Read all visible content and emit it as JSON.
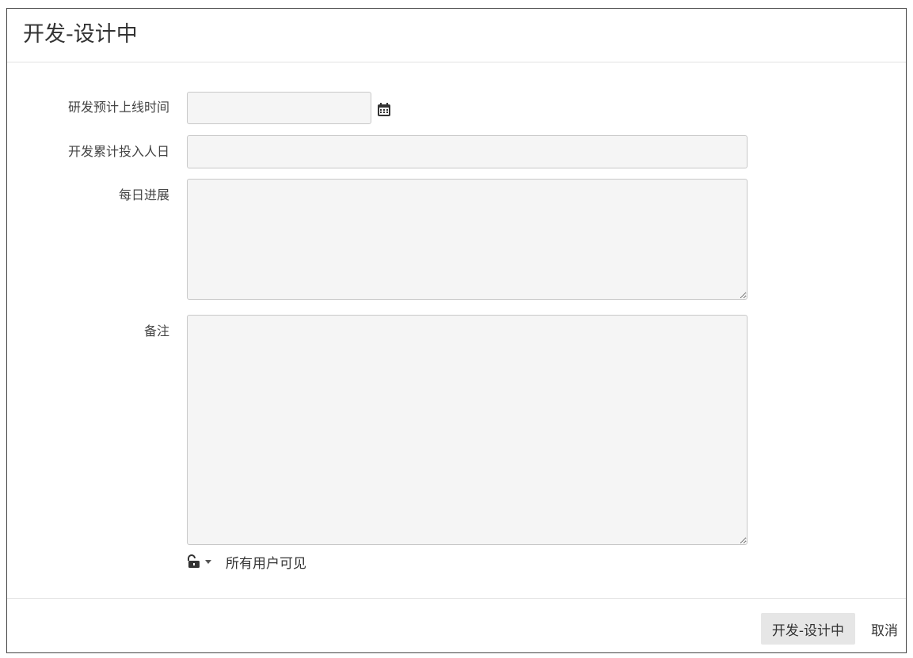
{
  "dialog": {
    "title": "开发-设计中"
  },
  "form": {
    "fields": [
      {
        "label": "研发预计上线时间",
        "value": "",
        "type": "date"
      },
      {
        "label": "开发累计投入人日",
        "value": "",
        "type": "text"
      },
      {
        "label": "每日进展",
        "value": "",
        "type": "textarea"
      },
      {
        "label": "备注",
        "value": "",
        "type": "textarea"
      }
    ],
    "visibility": {
      "label": "所有用户可见",
      "icon": "unlock-icon"
    }
  },
  "footer": {
    "submit_label": "开发-设计中",
    "cancel_label": "取消"
  },
  "colors": {
    "input_background": "#f5f5f5",
    "input_border": "#c8c8c8",
    "button_background": "#e6e6e6",
    "divider": "#e2e2e2",
    "frame_border": "#444444"
  }
}
